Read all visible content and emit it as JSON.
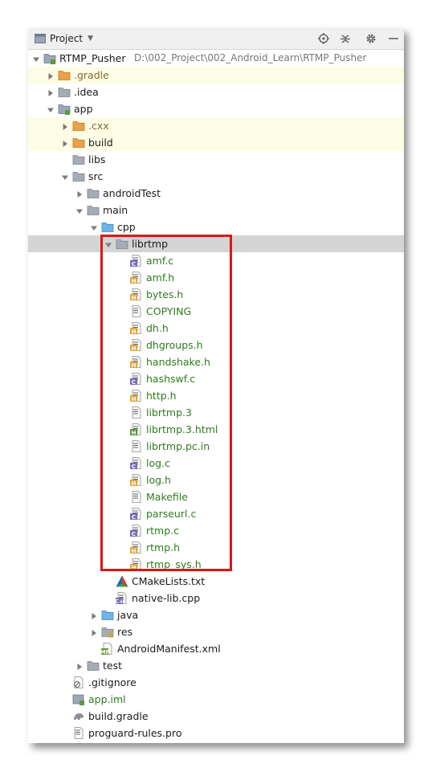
{
  "toolwindow": {
    "title": "Project",
    "buttons": [
      "locate-icon",
      "collapse-all-icon",
      "settings-gear-icon",
      "hide-minimize-icon"
    ]
  },
  "tree": [
    {
      "label": "RTMP_Pusher",
      "path": "D:\\002_Project\\002_Android_Learn\\RTMP_Pusher",
      "depth": 0,
      "arrow": "down",
      "icon": "module-folder-icon",
      "state": ""
    },
    {
      "label": ".gradle",
      "depth": 1,
      "arrow": "right",
      "icon": "orange-folder-icon",
      "state": "hl",
      "color": "brown"
    },
    {
      "label": ".idea",
      "depth": 1,
      "arrow": "right",
      "icon": "grey-folder-icon",
      "state": ""
    },
    {
      "label": "app",
      "depth": 1,
      "arrow": "down",
      "icon": "module-folder-icon",
      "state": ""
    },
    {
      "label": ".cxx",
      "depth": 2,
      "arrow": "right",
      "icon": "orange-folder-icon",
      "state": "hl",
      "color": "brown"
    },
    {
      "label": "build",
      "depth": 2,
      "arrow": "right",
      "icon": "orange-folder-icon",
      "state": "hl"
    },
    {
      "label": "libs",
      "depth": 2,
      "arrow": "",
      "icon": "grey-folder-icon",
      "state": ""
    },
    {
      "label": "src",
      "depth": 2,
      "arrow": "down",
      "icon": "grey-folder-icon",
      "state": ""
    },
    {
      "label": "androidTest",
      "depth": 3,
      "arrow": "right",
      "icon": "grey-folder-icon",
      "state": ""
    },
    {
      "label": "main",
      "depth": 3,
      "arrow": "down",
      "icon": "grey-folder-icon",
      "state": ""
    },
    {
      "label": "cpp",
      "depth": 4,
      "arrow": "down",
      "icon": "blue-folder-icon",
      "state": ""
    },
    {
      "label": "librtmp",
      "depth": 5,
      "arrow": "down",
      "icon": "grey-folder-icon",
      "state": "sel"
    },
    {
      "label": "amf.c",
      "depth": 6,
      "arrow": "",
      "icon": "c-file-icon",
      "state": "",
      "color": "green"
    },
    {
      "label": "amf.h",
      "depth": 6,
      "arrow": "",
      "icon": "h-file-icon",
      "state": "",
      "color": "green"
    },
    {
      "label": "bytes.h",
      "depth": 6,
      "arrow": "",
      "icon": "h-file-icon",
      "state": "",
      "color": "green"
    },
    {
      "label": "COPYING",
      "depth": 6,
      "arrow": "",
      "icon": "text-file-icon",
      "state": "",
      "color": "green"
    },
    {
      "label": "dh.h",
      "depth": 6,
      "arrow": "",
      "icon": "h-file-icon",
      "state": "",
      "color": "green"
    },
    {
      "label": "dhgroups.h",
      "depth": 6,
      "arrow": "",
      "icon": "h-file-icon",
      "state": "",
      "color": "green"
    },
    {
      "label": "handshake.h",
      "depth": 6,
      "arrow": "",
      "icon": "h-file-icon",
      "state": "",
      "color": "green"
    },
    {
      "label": "hashswf.c",
      "depth": 6,
      "arrow": "",
      "icon": "c-file-icon",
      "state": "",
      "color": "green"
    },
    {
      "label": "http.h",
      "depth": 6,
      "arrow": "",
      "icon": "h-file-icon",
      "state": "",
      "color": "green"
    },
    {
      "label": "librtmp.3",
      "depth": 6,
      "arrow": "",
      "icon": "text-file-icon",
      "state": "",
      "color": "green"
    },
    {
      "label": "librtmp.3.html",
      "depth": 6,
      "arrow": "",
      "icon": "html-file-icon",
      "state": "",
      "color": "green"
    },
    {
      "label": "librtmp.pc.in",
      "depth": 6,
      "arrow": "",
      "icon": "text-file-icon",
      "state": "",
      "color": "green"
    },
    {
      "label": "log.c",
      "depth": 6,
      "arrow": "",
      "icon": "c-file-icon",
      "state": "",
      "color": "green"
    },
    {
      "label": "log.h",
      "depth": 6,
      "arrow": "",
      "icon": "h-file-icon",
      "state": "",
      "color": "green"
    },
    {
      "label": "Makefile",
      "depth": 6,
      "arrow": "",
      "icon": "text-file-icon",
      "state": "",
      "color": "green"
    },
    {
      "label": "parseurl.c",
      "depth": 6,
      "arrow": "",
      "icon": "c-file-icon",
      "state": "",
      "color": "green"
    },
    {
      "label": "rtmp.c",
      "depth": 6,
      "arrow": "",
      "icon": "c-file-icon",
      "state": "",
      "color": "green"
    },
    {
      "label": "rtmp.h",
      "depth": 6,
      "arrow": "",
      "icon": "h-file-icon",
      "state": "",
      "color": "green"
    },
    {
      "label": "rtmp_sys.h",
      "depth": 6,
      "arrow": "",
      "icon": "h-file-icon",
      "state": "",
      "color": "green"
    },
    {
      "label": "CMakeLists.txt",
      "depth": 5,
      "arrow": "",
      "icon": "cmake-icon",
      "state": ""
    },
    {
      "label": "native-lib.cpp",
      "depth": 5,
      "arrow": "",
      "icon": "cpp-file-icon",
      "state": ""
    },
    {
      "label": "java",
      "depth": 4,
      "arrow": "right",
      "icon": "blue-folder-icon",
      "state": ""
    },
    {
      "label": "res",
      "depth": 4,
      "arrow": "right",
      "icon": "res-folder-icon",
      "state": ""
    },
    {
      "label": "AndroidManifest.xml",
      "depth": 4,
      "arrow": "",
      "icon": "manifest-file-icon",
      "state": ""
    },
    {
      "label": "test",
      "depth": 3,
      "arrow": "right",
      "icon": "grey-folder-icon",
      "state": ""
    },
    {
      "label": ".gitignore",
      "depth": 2,
      "arrow": "",
      "icon": "gitignore-file-icon",
      "state": ""
    },
    {
      "label": "app.iml",
      "depth": 2,
      "arrow": "",
      "icon": "iml-file-icon",
      "state": "",
      "color": "green"
    },
    {
      "label": "build.gradle",
      "depth": 2,
      "arrow": "",
      "icon": "gradle-icon",
      "state": ""
    },
    {
      "label": "proguard-rules.pro",
      "depth": 2,
      "arrow": "",
      "icon": "text-file-icon",
      "state": ""
    }
  ]
}
